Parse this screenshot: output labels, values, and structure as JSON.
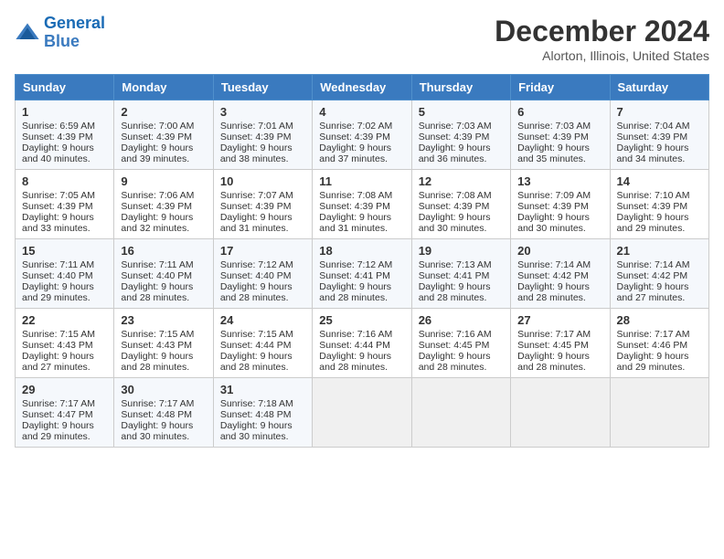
{
  "logo": {
    "line1": "General",
    "line2": "Blue"
  },
  "title": "December 2024",
  "location": "Alorton, Illinois, United States",
  "weekdays": [
    "Sunday",
    "Monday",
    "Tuesday",
    "Wednesday",
    "Thursday",
    "Friday",
    "Saturday"
  ],
  "weeks": [
    [
      {
        "day": "1",
        "sunrise": "6:59 AM",
        "sunset": "4:39 PM",
        "daylight": "9 hours and 40 minutes."
      },
      {
        "day": "2",
        "sunrise": "7:00 AM",
        "sunset": "4:39 PM",
        "daylight": "9 hours and 39 minutes."
      },
      {
        "day": "3",
        "sunrise": "7:01 AM",
        "sunset": "4:39 PM",
        "daylight": "9 hours and 38 minutes."
      },
      {
        "day": "4",
        "sunrise": "7:02 AM",
        "sunset": "4:39 PM",
        "daylight": "9 hours and 37 minutes."
      },
      {
        "day": "5",
        "sunrise": "7:03 AM",
        "sunset": "4:39 PM",
        "daylight": "9 hours and 36 minutes."
      },
      {
        "day": "6",
        "sunrise": "7:03 AM",
        "sunset": "4:39 PM",
        "daylight": "9 hours and 35 minutes."
      },
      {
        "day": "7",
        "sunrise": "7:04 AM",
        "sunset": "4:39 PM",
        "daylight": "9 hours and 34 minutes."
      }
    ],
    [
      {
        "day": "8",
        "sunrise": "7:05 AM",
        "sunset": "4:39 PM",
        "daylight": "9 hours and 33 minutes."
      },
      {
        "day": "9",
        "sunrise": "7:06 AM",
        "sunset": "4:39 PM",
        "daylight": "9 hours and 32 minutes."
      },
      {
        "day": "10",
        "sunrise": "7:07 AM",
        "sunset": "4:39 PM",
        "daylight": "9 hours and 31 minutes."
      },
      {
        "day": "11",
        "sunrise": "7:08 AM",
        "sunset": "4:39 PM",
        "daylight": "9 hours and 31 minutes."
      },
      {
        "day": "12",
        "sunrise": "7:08 AM",
        "sunset": "4:39 PM",
        "daylight": "9 hours and 30 minutes."
      },
      {
        "day": "13",
        "sunrise": "7:09 AM",
        "sunset": "4:39 PM",
        "daylight": "9 hours and 30 minutes."
      },
      {
        "day": "14",
        "sunrise": "7:10 AM",
        "sunset": "4:39 PM",
        "daylight": "9 hours and 29 minutes."
      }
    ],
    [
      {
        "day": "15",
        "sunrise": "7:11 AM",
        "sunset": "4:40 PM",
        "daylight": "9 hours and 29 minutes."
      },
      {
        "day": "16",
        "sunrise": "7:11 AM",
        "sunset": "4:40 PM",
        "daylight": "9 hours and 28 minutes."
      },
      {
        "day": "17",
        "sunrise": "7:12 AM",
        "sunset": "4:40 PM",
        "daylight": "9 hours and 28 minutes."
      },
      {
        "day": "18",
        "sunrise": "7:12 AM",
        "sunset": "4:41 PM",
        "daylight": "9 hours and 28 minutes."
      },
      {
        "day": "19",
        "sunrise": "7:13 AM",
        "sunset": "4:41 PM",
        "daylight": "9 hours and 28 minutes."
      },
      {
        "day": "20",
        "sunrise": "7:14 AM",
        "sunset": "4:42 PM",
        "daylight": "9 hours and 28 minutes."
      },
      {
        "day": "21",
        "sunrise": "7:14 AM",
        "sunset": "4:42 PM",
        "daylight": "9 hours and 27 minutes."
      }
    ],
    [
      {
        "day": "22",
        "sunrise": "7:15 AM",
        "sunset": "4:43 PM",
        "daylight": "9 hours and 27 minutes."
      },
      {
        "day": "23",
        "sunrise": "7:15 AM",
        "sunset": "4:43 PM",
        "daylight": "9 hours and 28 minutes."
      },
      {
        "day": "24",
        "sunrise": "7:15 AM",
        "sunset": "4:44 PM",
        "daylight": "9 hours and 28 minutes."
      },
      {
        "day": "25",
        "sunrise": "7:16 AM",
        "sunset": "4:44 PM",
        "daylight": "9 hours and 28 minutes."
      },
      {
        "day": "26",
        "sunrise": "7:16 AM",
        "sunset": "4:45 PM",
        "daylight": "9 hours and 28 minutes."
      },
      {
        "day": "27",
        "sunrise": "7:17 AM",
        "sunset": "4:45 PM",
        "daylight": "9 hours and 28 minutes."
      },
      {
        "day": "28",
        "sunrise": "7:17 AM",
        "sunset": "4:46 PM",
        "daylight": "9 hours and 29 minutes."
      }
    ],
    [
      {
        "day": "29",
        "sunrise": "7:17 AM",
        "sunset": "4:47 PM",
        "daylight": "9 hours and 29 minutes."
      },
      {
        "day": "30",
        "sunrise": "7:17 AM",
        "sunset": "4:48 PM",
        "daylight": "9 hours and 30 minutes."
      },
      {
        "day": "31",
        "sunrise": "7:18 AM",
        "sunset": "4:48 PM",
        "daylight": "9 hours and 30 minutes."
      },
      null,
      null,
      null,
      null
    ]
  ]
}
